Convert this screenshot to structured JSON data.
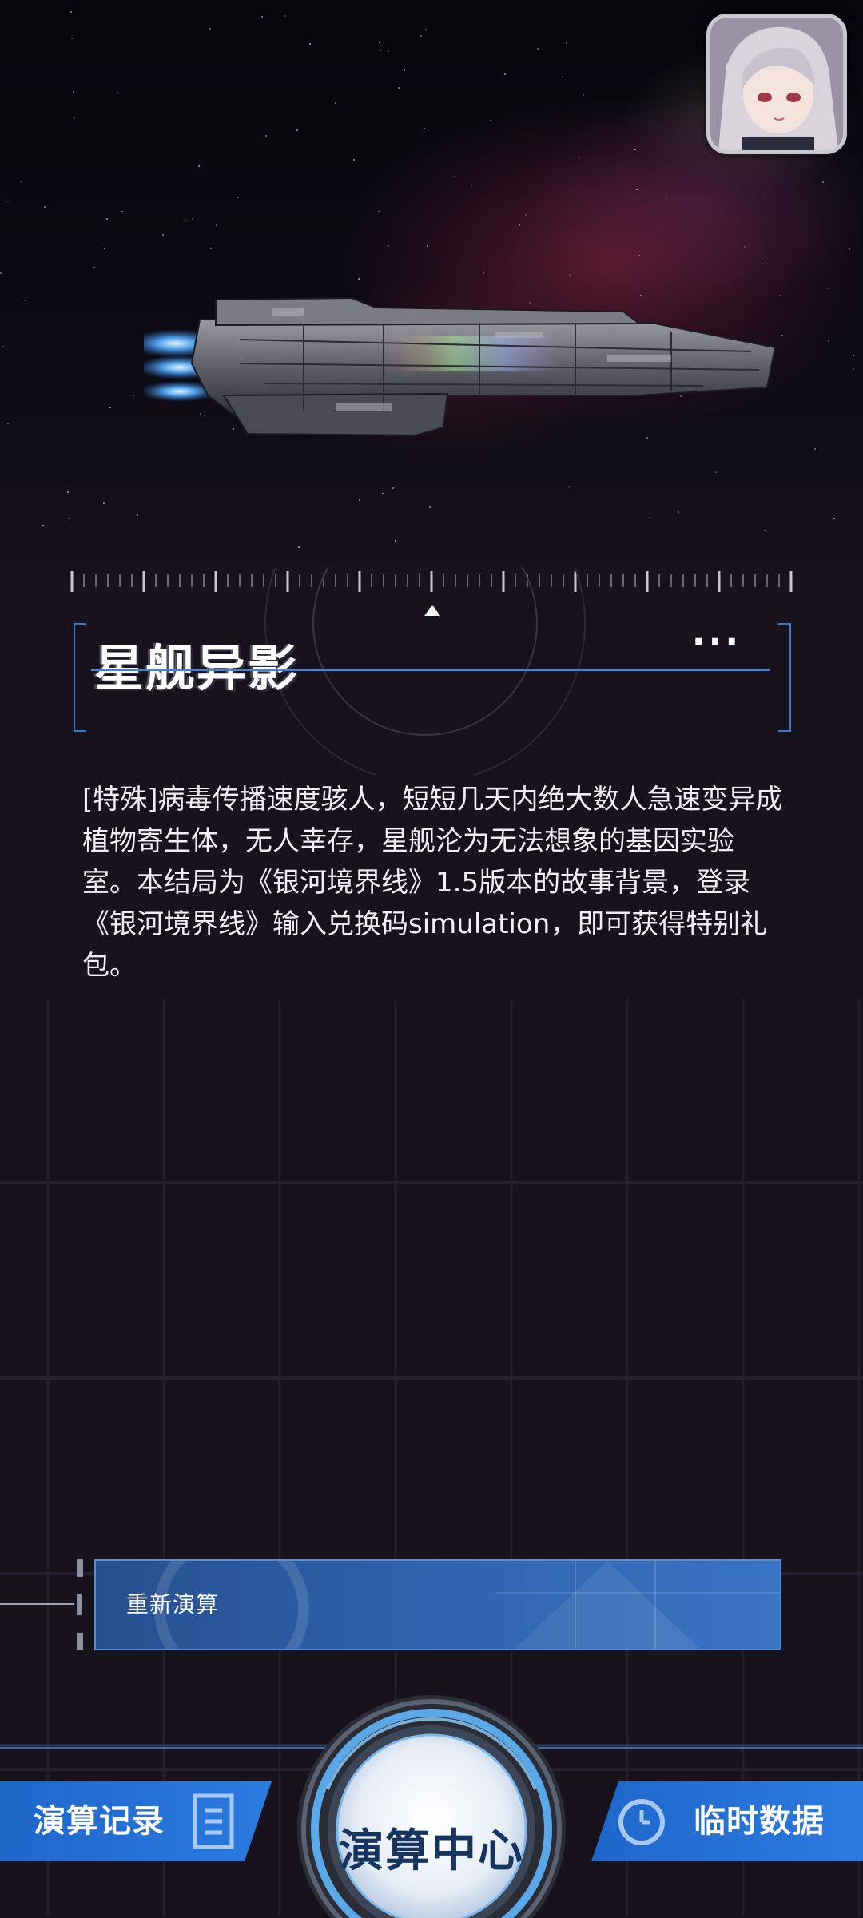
{
  "header": {
    "title": "星舰异影",
    "more_label": "···"
  },
  "description": "[特殊]病毒传播速度骇人，短短几天内绝大数人急速变异成植物寄生体，无人幸存，星舰沦为无法想象的基因实验室。本结局为《银河境界线》1.5版本的故事背景，登录《银河境界线》输入兑换码simulation，即可获得特别礼包。",
  "actions": {
    "recalculate_label": "重新演算"
  },
  "bottom_nav": {
    "records_label": "演算记录",
    "center_label": "演算中心",
    "temp_data_label": "临时数据"
  },
  "colors": {
    "accent_blue": "#2c7be0",
    "frame_blue": "#3a87d4",
    "background": "#17121c",
    "button_blue": "#2e63ad"
  },
  "icons": {
    "records": "document-list-icon",
    "temp_data": "clock-icon",
    "more": "ellipsis-icon"
  }
}
